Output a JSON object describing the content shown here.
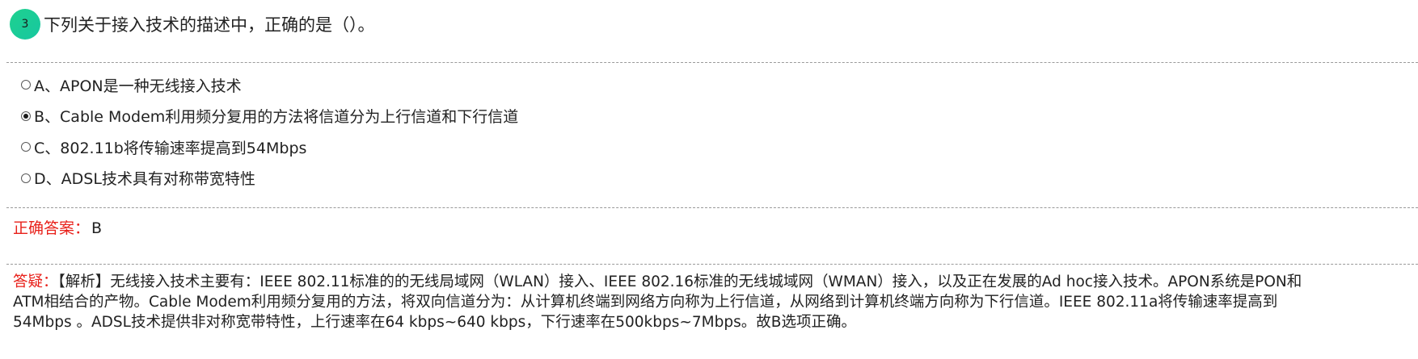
{
  "question": {
    "number": "3",
    "stem": "下列关于接入技术的描述中，正确的是（）。"
  },
  "options": [
    {
      "label": "A、APON是一种无线接入技术",
      "selected": false
    },
    {
      "label": "B、Cable Modem利用频分复用的方法将信道分为上行信道和下行信道",
      "selected": true
    },
    {
      "label": "C、802.11b将传输速率提高到54Mbps",
      "selected": false
    },
    {
      "label": "D、ADSL技术具有对称带宽特性",
      "selected": false
    }
  ],
  "answer": {
    "label": "正确答案：",
    "value": "B"
  },
  "explanation": {
    "label": "答疑：",
    "lines": [
      "【解析】无线接入技术主要有：IEEE 802.11标准的的无线局域网（WLAN）接入、IEEE 802.16标准的无线城域网（WMAN）接入，以及正在发展的Ad hoc接入技术。APON系统是PON和",
      "ATM相结合的产物。Cable Modem利用频分复用的方法，将双向信道分为：从计算机终端到网络方向称为上行信道，从网络到计算机终端方向称为下行信道。IEEE 802.11a将传输速率提高到",
      "54Mbps 。ADSL技术提供非对称宽带特性，上行速率在64 kbps~640 kbps，下行速率在500kbps~7Mbps。故B选项正确。"
    ]
  },
  "colors": {
    "badge": "#1fd18f",
    "label_red": "#e8201a",
    "text": "#222222",
    "divider": "#9a9a9a"
  }
}
